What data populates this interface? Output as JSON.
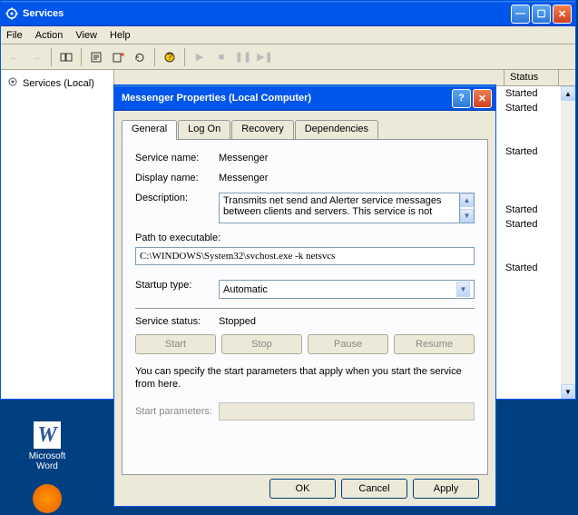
{
  "services_window": {
    "title": "Services",
    "menu": {
      "file": "File",
      "action": "Action",
      "view": "View",
      "help": "Help"
    },
    "tree_item": "Services (Local)",
    "col_status": "Status",
    "status_values": [
      "Started",
      "Started",
      "",
      "Started",
      "",
      "Started",
      "Started",
      "",
      "Started",
      ""
    ]
  },
  "dialog": {
    "title": "Messenger Properties (Local Computer)",
    "tabs": {
      "general": "General",
      "logon": "Log On",
      "recovery": "Recovery",
      "dependencies": "Dependencies"
    },
    "labels": {
      "service_name": "Service name:",
      "display_name": "Display name:",
      "description": "Description:",
      "path": "Path to executable:",
      "startup_type": "Startup type:",
      "service_status": "Service status:",
      "start_params": "Start parameters:"
    },
    "values": {
      "service_name": "Messenger",
      "display_name": "Messenger",
      "description": "Transmits net send and Alerter service messages between clients and servers. This service is not",
      "path": "C:\\WINDOWS\\System32\\svchost.exe -k netsvcs",
      "startup_type": "Automatic",
      "service_status": "Stopped"
    },
    "buttons": {
      "start": "Start",
      "stop": "Stop",
      "pause": "Pause",
      "resume": "Resume"
    },
    "help_text": "You can specify the start parameters that apply when you start the service from here.",
    "dlg_buttons": {
      "ok": "OK",
      "cancel": "Cancel",
      "apply": "Apply"
    }
  },
  "desktop": {
    "word": "Microsoft Word"
  }
}
